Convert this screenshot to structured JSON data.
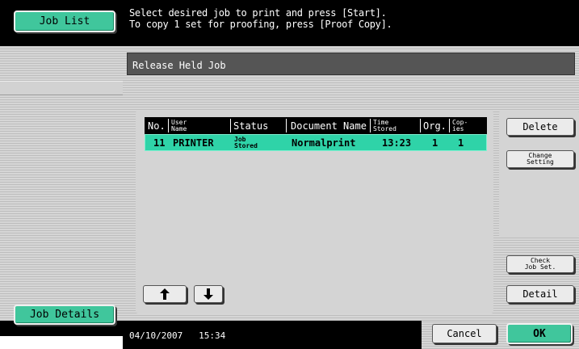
{
  "left_panel": {
    "job_list_label": "Job List",
    "job_details_label": "Job Details"
  },
  "message": {
    "line1": "Select desired job to print and press [Start].",
    "line2": "To copy 1 set for proofing, press [Proof Copy]."
  },
  "panel_title": "Release Held Job",
  "table": {
    "columns": {
      "no": "No.",
      "user_name_1": "User",
      "user_name_2": "Name",
      "status": "Status",
      "document_name": "Document Name",
      "time_stored_1": "Time",
      "time_stored_2": "Stored",
      "org": "Org.",
      "copies_1": "Cop-",
      "copies_2": "ies"
    },
    "rows": [
      {
        "no": "11",
        "user_name": "PRINTER",
        "status_1": "Job",
        "status_2": "Stored",
        "document_name": "Normalprint",
        "time_stored": "13:23",
        "org": "1",
        "copies": "1"
      }
    ]
  },
  "buttons": {
    "delete": "Delete",
    "change_setting_1": "Change",
    "change_setting_2": "Setting",
    "check_job_set_1": "Check",
    "check_job_set_2": "Job Set.",
    "detail": "Detail",
    "cancel": "Cancel",
    "ok": "OK",
    "scroll_up_icon": "arrow-up-icon",
    "scroll_down_icon": "arrow-down-icon"
  },
  "status": {
    "date": "04/10/2007",
    "time": "15:34"
  },
  "colors": {
    "accent_green": "#40c69c",
    "selected_row": "#2fd3a8",
    "header_black": "#000000"
  }
}
